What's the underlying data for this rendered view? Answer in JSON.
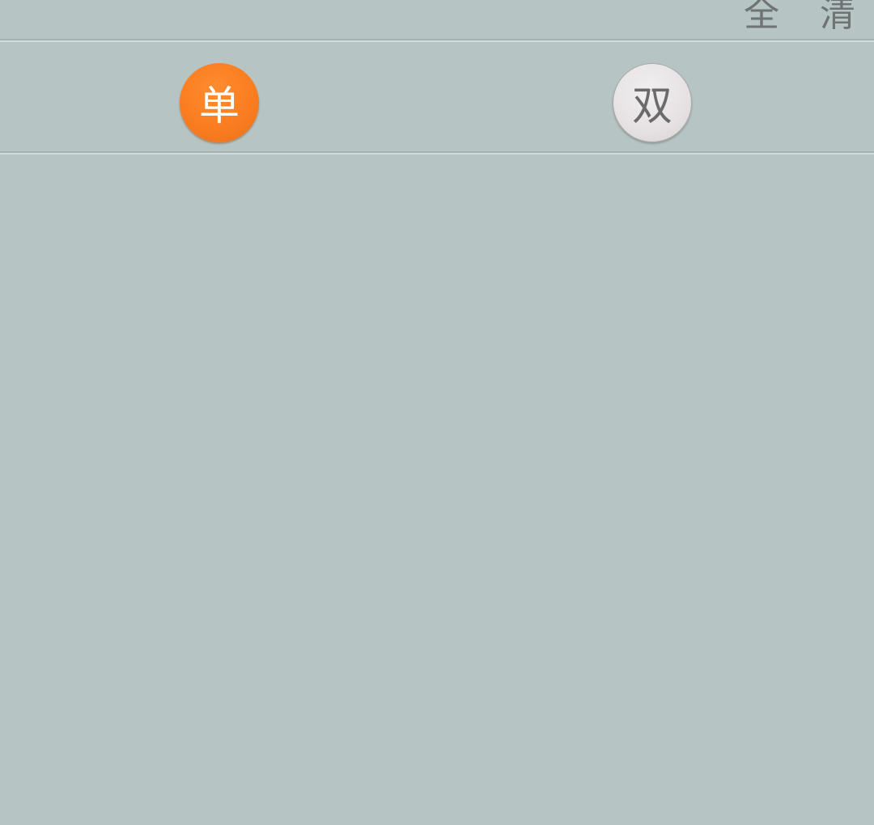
{
  "top_bar": {
    "select_all_label": "全",
    "clear_label": "清"
  },
  "options": {
    "single_label": "单",
    "double_label": "双",
    "selected": "单"
  },
  "colors": {
    "background": "#b7c4c4",
    "selected_ball": "#f97c1f",
    "unselected_ball": "#e6e2e3",
    "top_text": "#6e7373"
  }
}
